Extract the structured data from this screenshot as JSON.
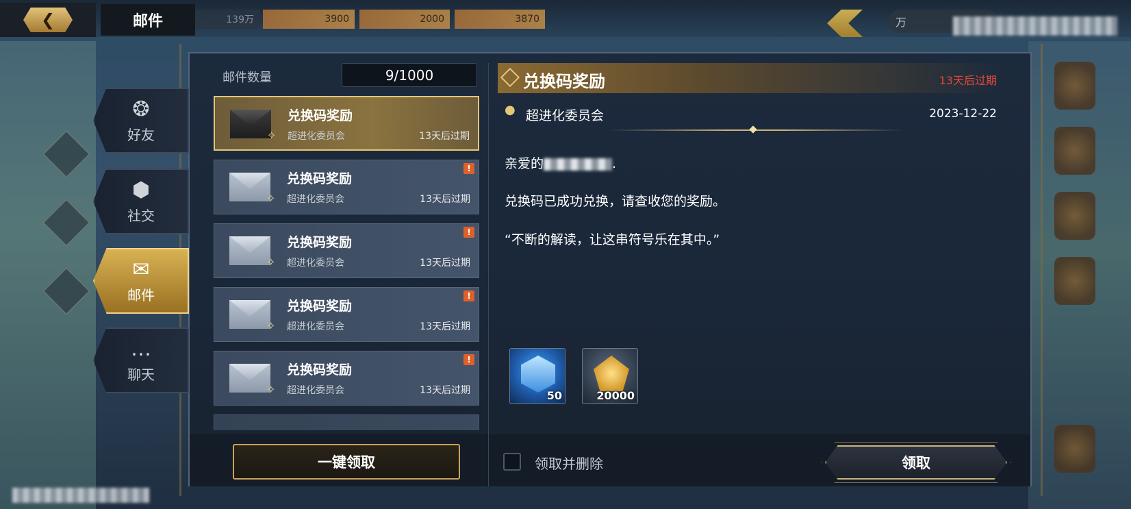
{
  "topbar": {
    "title": "邮件",
    "back_icon": "back-arrow-icon",
    "resources": [
      "139万",
      "3900",
      "2000",
      "3870"
    ],
    "event_label": "万"
  },
  "tabs": [
    {
      "label": "好友",
      "icon": "friend-pin-icon"
    },
    {
      "label": "社交",
      "icon": "social-network-icon"
    },
    {
      "label": "邮件",
      "icon": "envelope-icon",
      "active": true
    },
    {
      "label": "聊天",
      "icon": "chat-bubble-icon"
    }
  ],
  "mail_list": {
    "count_label": "邮件数量",
    "count_value": "9/1000",
    "items": [
      {
        "title": "兑换码奖励",
        "sender": "超进化委员会",
        "expire": "13天后过期",
        "selected": true
      },
      {
        "title": "兑换码奖励",
        "sender": "超进化委员会",
        "expire": "13天后过期",
        "alert": "!"
      },
      {
        "title": "兑换码奖励",
        "sender": "超进化委员会",
        "expire": "13天后过期",
        "alert": "!"
      },
      {
        "title": "兑换码奖励",
        "sender": "超进化委员会",
        "expire": "13天后过期",
        "alert": "!"
      },
      {
        "title": "兑换码奖励",
        "sender": "超进化委员会",
        "expire": "13天后过期",
        "alert": "!"
      }
    ]
  },
  "detail": {
    "title": "兑换码奖励",
    "expire": "13天后过期",
    "sender": "超进化委员会",
    "date": "2023-12-22",
    "greeting": "亲爱的",
    "greeting_suffix": ".",
    "body_line1": "兑换码已成功兑换，请查收您的奖励。",
    "body_line2": "“不断的解读，让这串符号乐在其中。”",
    "rewards": [
      {
        "icon": "blue-gem-icon",
        "qty": "50"
      },
      {
        "icon": "gold-coin-icon",
        "qty": "20000"
      }
    ]
  },
  "bottom": {
    "claim_all": "一键领取",
    "delete_label": "领取并删除",
    "claim": "领取"
  },
  "colors": {
    "accent_gold": "#e2c77a",
    "expire_red": "#e2473b",
    "alert_orange": "#e0602a"
  }
}
